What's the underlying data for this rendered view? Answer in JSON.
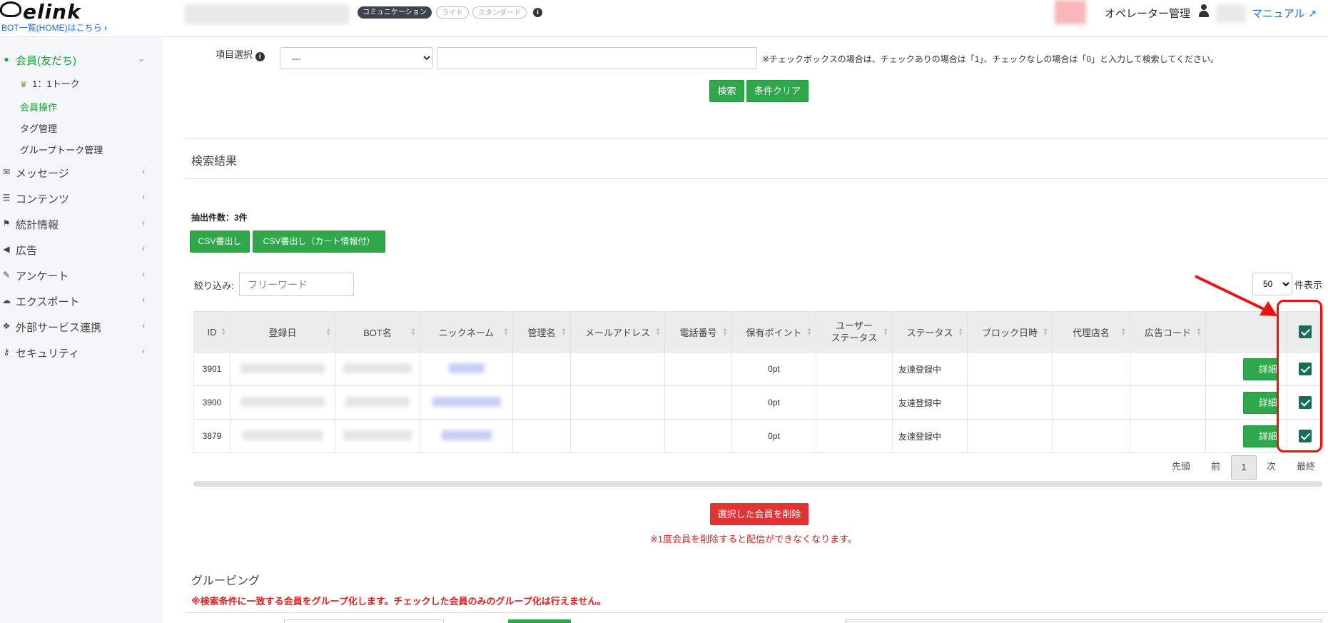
{
  "header": {
    "logo": "elink",
    "bot_link": "BOT一覧(HOME)はこちら",
    "badges": [
      "コミュニケーション",
      "ライト",
      "スタンダード"
    ],
    "operator_label": "オペレーター管理",
    "manual_label": "マニュアル"
  },
  "sidebar": {
    "member": "会員(友だち)",
    "sub_items": [
      "1：1トーク",
      "会員操作",
      "タグ管理",
      "グループトーク管理"
    ],
    "items": [
      "メッセージ",
      "コンテンツ",
      "統計情報",
      "広告",
      "アンケート",
      "エクスポート",
      "外部サービス連携",
      "セキュリティ"
    ]
  },
  "search": {
    "field_label": "項目選択",
    "select_value": "---",
    "note": "※チェックボックスの場合は、チェックありの場合は「1」、チェックなしの場合は「0」と入力して検索してください。",
    "search_button": "検索",
    "clear_button": "条件クリア"
  },
  "results": {
    "title": "検索結果",
    "count_label": "抽出件数：3件",
    "csv_button": "CSV書出し",
    "csv_cart_button": "CSV書出し（カート情報付）",
    "filter_label": "絞り込み:",
    "filter_placeholder": "フリーワード",
    "per_page_value": "50",
    "per_page_label": "件表示"
  },
  "table": {
    "headers": [
      "ID",
      "登録日",
      "BOT名",
      "ニックネーム",
      "管理名",
      "メールアドレス",
      "電話番号",
      "保有ポイント",
      "ユーザー\nステータス",
      "ステータス",
      "ブロック日時",
      "代理店名",
      "広告コード"
    ],
    "detail_label": "詳細",
    "rows": [
      {
        "id": "3901",
        "points": "0pt",
        "status": "友達登録中"
      },
      {
        "id": "3900",
        "points": "0pt",
        "status": "友達登録中"
      },
      {
        "id": "3879",
        "points": "0pt",
        "status": "友達登録中"
      }
    ]
  },
  "pager": {
    "first": "先頭",
    "prev": "前",
    "current": "1",
    "next": "次",
    "last": "最終"
  },
  "delete": {
    "button": "選択した会員を削除",
    "warning": "※1度会員を削除すると配信ができなくなります。"
  },
  "grouping": {
    "title": "グルーピング",
    "warning": "※検索条件に一致する会員をグループ化します。チェックした会員のみのグループ化は行えません。"
  },
  "colors": {
    "accent_green": "#2ea84a",
    "danger_red": "#e03434",
    "checkbox": "#1a6b5a",
    "annotation_red": "#ee1111"
  }
}
